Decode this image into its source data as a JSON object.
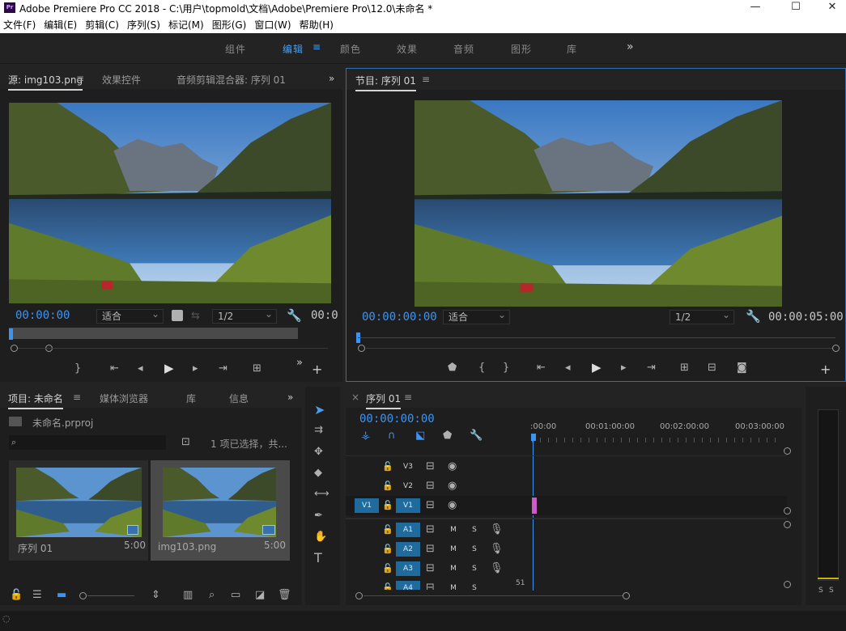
{
  "window": {
    "app_badge": "Pr",
    "title": "Adobe Premiere Pro CC 2018 - C:\\用户\\topmold\\文档\\Adobe\\Premiere Pro\\12.0\\未命名 *",
    "minimize": "—",
    "maximize": "☐",
    "close": "✕"
  },
  "menu": [
    "文件(F)",
    "编辑(E)",
    "剪辑(C)",
    "序列(S)",
    "标记(M)",
    "图形(G)",
    "窗口(W)",
    "帮助(H)"
  ],
  "workspaces": {
    "items": [
      "组件",
      "编辑",
      "颜色",
      "效果",
      "音频",
      "图形",
      "库"
    ],
    "active": "编辑",
    "more": "»",
    "menu_icon": "≡"
  },
  "source_panel": {
    "tabs": [
      "源: img103.png",
      "效果控件",
      "音频剪辑混合器: 序列 01"
    ],
    "menu_icon": "≡",
    "more": "»",
    "timecode_in": "00:00:00",
    "fit": "适合",
    "resolution": "1/2",
    "timecode_out": "00:0"
  },
  "program_panel": {
    "tab": "节目: 序列 01",
    "menu_icon": "≡",
    "timecode_in": "00:00:00:00",
    "fit": "适合",
    "resolution": "1/2",
    "timecode_out": "00:00:05:00"
  },
  "project_panel": {
    "tabs": [
      "项目: 未命名",
      "媒体浏览器",
      "库",
      "信息"
    ],
    "menu_icon": "≡",
    "more": "»",
    "project_file": "未命名.prproj",
    "selection_status": "1 项已选择，共...",
    "items": [
      {
        "name": "序列 01",
        "duration": "5:00"
      },
      {
        "name": "img103.png",
        "duration": "5:00"
      }
    ]
  },
  "timeline_panel": {
    "tab": "序列 01",
    "menu_icon": "≡",
    "close": "×",
    "timecode": "00:00:00:00",
    "ruler": [
      ":00:00",
      "00:01:00:00",
      "00:02:00:00",
      "00:03:00:00"
    ],
    "video_tracks": [
      {
        "label": "V3",
        "source": ""
      },
      {
        "label": "V2",
        "source": ""
      },
      {
        "label": "V1",
        "source": "V1"
      }
    ],
    "audio_tracks": [
      {
        "label": "A1",
        "mute": "M",
        "solo": "S"
      },
      {
        "label": "A2",
        "mute": "M",
        "solo": "S"
      },
      {
        "label": "A3",
        "mute": "M",
        "solo": "S"
      },
      {
        "label": "A4",
        "mute": "M",
        "solo": "S"
      }
    ],
    "footer_value": "51"
  },
  "audio_meter": {
    "solo_left": "S",
    "solo_right": "S"
  },
  "colors": {
    "accent": "#3e93f0",
    "track_blue": "#1f6b9e",
    "clip_pink": "#d05ac8",
    "panel_bg": "#1e1e1e"
  }
}
